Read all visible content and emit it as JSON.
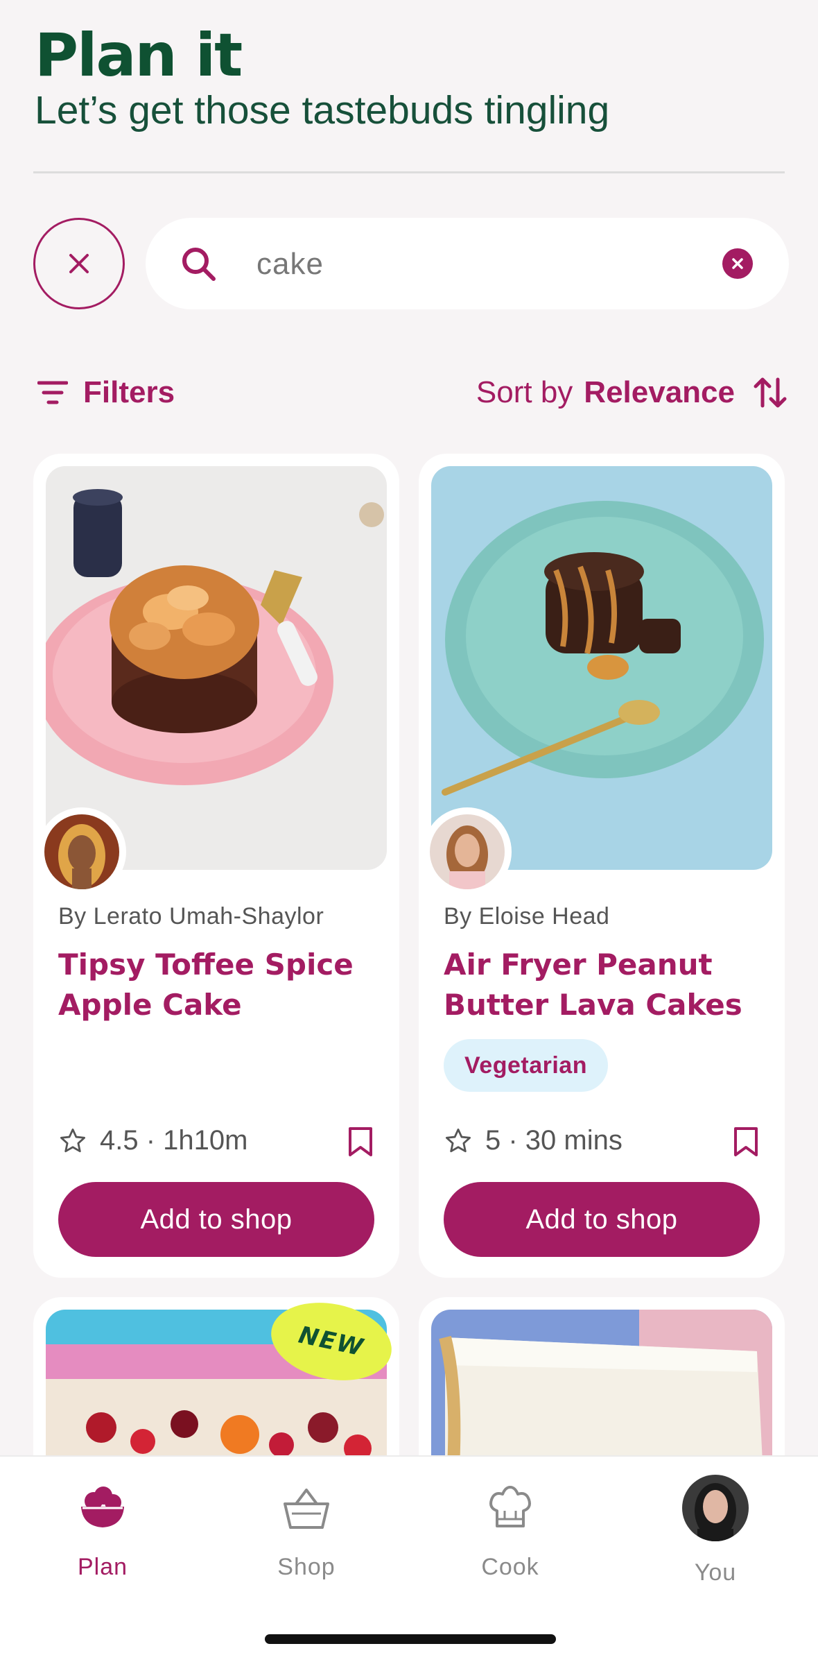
{
  "header": {
    "title": "Plan it",
    "subtitle": "Let’s get those tastebuds tingling"
  },
  "search": {
    "query": "cake",
    "close_icon": "close-icon",
    "search_icon": "search-icon",
    "clear_icon": "clear-icon"
  },
  "toolbar": {
    "filters_label": "Filters",
    "sort_prefix": "Sort by",
    "sort_value": "Relevance"
  },
  "recipes": [
    {
      "author": "By Lerato Umah-Shaylor",
      "title": "Tipsy Toffee Spice Apple Cake",
      "tag": "",
      "rating": "4.5",
      "time": "1h10m",
      "meta": "4.5 · 1h10m",
      "button": "Add to shop"
    },
    {
      "author": "By Eloise Head",
      "title": "Air Fryer Peanut Butter Lava Cakes",
      "tag": "Vegetarian",
      "rating": "5",
      "time": "30 mins",
      "meta": "5 · 30 mins",
      "button": "Add to shop"
    }
  ],
  "peek": {
    "badge": "NEW"
  },
  "nav": {
    "items": [
      {
        "label": "Plan",
        "icon": "bowl-icon",
        "active": true
      },
      {
        "label": "Shop",
        "icon": "basket-icon",
        "active": false
      },
      {
        "label": "Cook",
        "icon": "chef-hat-icon",
        "active": false
      },
      {
        "label": "You",
        "icon": "profile-avatar",
        "active": false
      }
    ]
  },
  "colors": {
    "brand": "#a31c62",
    "title_green": "#0f5132",
    "background": "#f7f4f5",
    "tag_bg": "#def2fb",
    "badge_yellow": "#e6f34a"
  }
}
